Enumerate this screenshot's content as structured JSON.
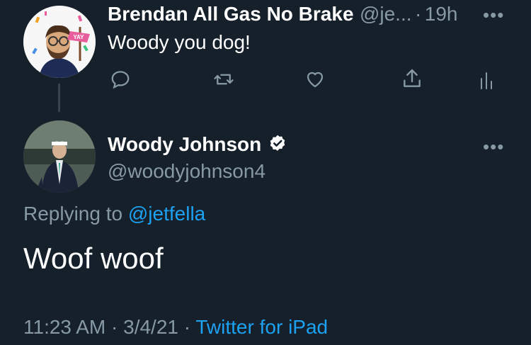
{
  "parent_tweet": {
    "display_name": "Brendan All Gas No Brake",
    "handle": "@je...",
    "separator": "·",
    "time": "19h",
    "text": "Woody you dog!",
    "avatar_badge": "YAY"
  },
  "main_tweet": {
    "display_name": "Woody Johnson",
    "handle": "@woodyjohnson4",
    "replying_prefix": "Replying to",
    "replying_to": "@jetfella",
    "text": "Woof woof",
    "time": "11:23 AM",
    "date": "3/4/21",
    "source": "Twitter for iPad",
    "dot1": "·",
    "dot2": "·"
  },
  "colors": {
    "background": "#15202b",
    "text": "#ffffff",
    "muted": "#8899a6",
    "link": "#1da1f2",
    "divider": "#38444d"
  }
}
